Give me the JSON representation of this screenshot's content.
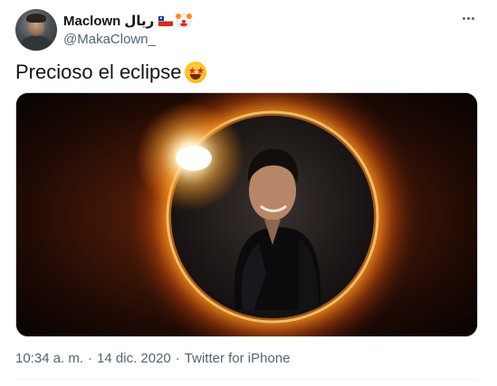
{
  "author": {
    "display_name": "Maclown",
    "name_suffix": "ريال",
    "handle": "@MakaClown_"
  },
  "icons": {
    "avatar": "profile-photo",
    "flag": "chile-flag-icon",
    "clown": "clown-face-icon",
    "more": "more-options-icon",
    "emoji": "star-struck-emoji"
  },
  "tweet": {
    "text": "Precioso el eclipse"
  },
  "media": {
    "description_icon": "solar-eclipse-photo"
  },
  "meta": {
    "time": "10:34 a. m.",
    "separator": "·",
    "date": "14 dic. 2020",
    "source": "Twitter for iPhone"
  },
  "colors": {
    "text_primary": "#0f1419",
    "text_secondary": "#536471",
    "divider": "#eff3f4"
  }
}
